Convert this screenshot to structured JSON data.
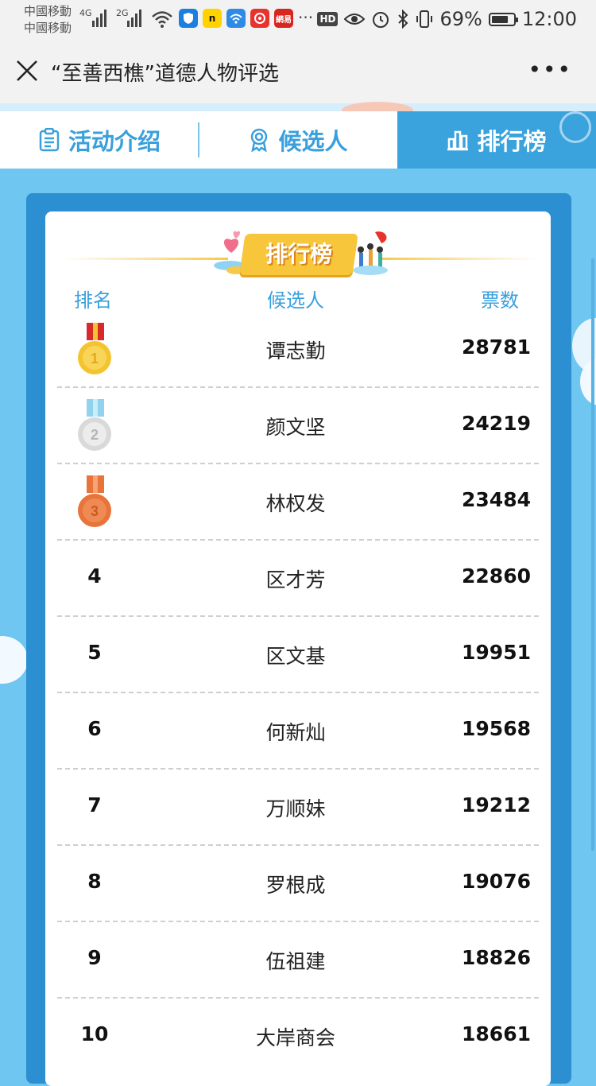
{
  "status_bar": {
    "carrier1": "中國移動",
    "carrier2": "中國移動",
    "net1": "4G",
    "net2": "2G",
    "app_icons": [
      "n",
      "網易"
    ],
    "more": "···",
    "hd": "HD",
    "battery_pct": "69%",
    "time": "12:00"
  },
  "title_bar": {
    "title": "“至善西樵”道德人物评选"
  },
  "tabs": [
    {
      "label": "活动介绍"
    },
    {
      "label": "候选人"
    },
    {
      "label": "排行榜"
    }
  ],
  "leaderboard": {
    "banner": "排行榜",
    "headers": {
      "rank": "排名",
      "candidate": "候选人",
      "votes": "票数"
    },
    "rows": [
      {
        "rank": "1",
        "name": "谭志勤",
        "votes": "28781"
      },
      {
        "rank": "2",
        "name": "颜文坚",
        "votes": "24219"
      },
      {
        "rank": "3",
        "name": "林权发",
        "votes": "23484"
      },
      {
        "rank": "4",
        "name": "区才芳",
        "votes": "22860"
      },
      {
        "rank": "5",
        "name": "区文基",
        "votes": "19951"
      },
      {
        "rank": "6",
        "name": "何新灿",
        "votes": "19568"
      },
      {
        "rank": "7",
        "name": "万顺妹",
        "votes": "19212"
      },
      {
        "rank": "8",
        "name": "罗根成",
        "votes": "19076"
      },
      {
        "rank": "9",
        "name": "伍祖建",
        "votes": "18826"
      },
      {
        "rank": "10",
        "name": "大岸商会",
        "votes": "18661"
      }
    ]
  },
  "colors": {
    "accent": "#3aa0dc",
    "tab_active_bg": "#3aa3dd",
    "board_frame": "#2b8fd1",
    "banner_gold": "#f7c63a",
    "gold_medal": "#f4c430",
    "silver_medal": "#d9d9d9",
    "bronze_medal": "#e8743a"
  }
}
